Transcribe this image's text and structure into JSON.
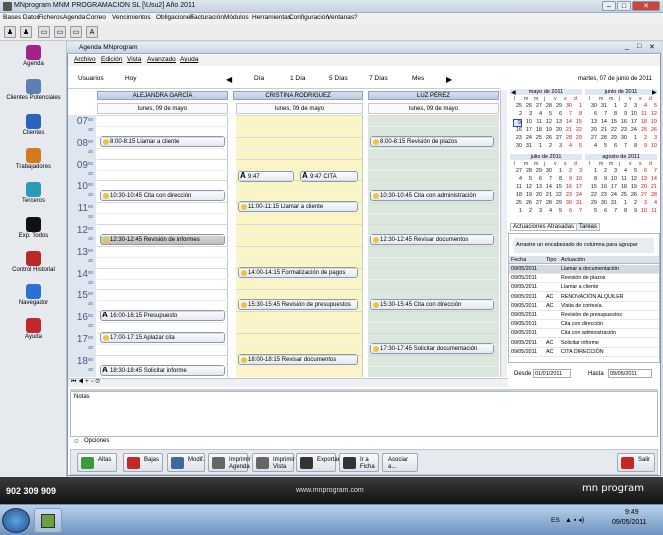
{
  "window": {
    "title": "MNprogram MNM PROGRAMACION SL [\\Usu2] Año 2011"
  },
  "menubar": [
    "Bases Datos",
    "Ficheros",
    "Agenda",
    "Correo",
    "Vencimientos",
    "Obligaciones",
    "Facturación",
    "Módulos",
    "Herramientas",
    "Configuración",
    "Ventanas",
    "?"
  ],
  "sidebar": [
    {
      "label": "Agenda",
      "icon": "agenda-icon"
    },
    {
      "label": "Clientes Potenciales",
      "icon": "potential-clients-icon"
    },
    {
      "label": "Clientes",
      "icon": "clients-icon"
    },
    {
      "label": "Trabajadores",
      "icon": "workers-icon"
    },
    {
      "label": "Terceros",
      "icon": "third-parties-icon"
    },
    {
      "label": "Exp. Todos",
      "icon": "expedients-icon"
    },
    {
      "label": "Control Historial",
      "icon": "history-icon"
    },
    {
      "label": "Navegador",
      "icon": "browser-icon"
    },
    {
      "label": "Ayuda",
      "icon": "help-icon"
    }
  ],
  "inner": {
    "title": "Agenda MNprogram",
    "menu": [
      "Archivo",
      "Edición",
      "Vista",
      "Avanzado",
      "Ayuda"
    ]
  },
  "nav": {
    "usuarios": "Usuarios",
    "hoy": "Hoy",
    "dia": "Día",
    "dia1": "1 Día",
    "dias5": "5 Días",
    "dias7": "7 Días",
    "mes": "Mes",
    "date": "martes, 07 de junio de 2011"
  },
  "columns": [
    {
      "name": "ALEJANDRA GARCÍA",
      "day": "lunes, 09 de mayo"
    },
    {
      "name": "CRISTINA RODRIGUEZ",
      "day": "lunes, 09 de mayo"
    },
    {
      "name": "LUZ PÉREZ",
      "day": "lunes, 09 de mayo"
    }
  ],
  "hours": [
    "07",
    "08",
    "09",
    "10",
    "11",
    "12",
    "13",
    "14",
    "15",
    "16",
    "17",
    "18"
  ],
  "appointments": {
    "c1": [
      "8:00-8:15 Llamar a cliente",
      "10:30-10:45 Cita con dirección",
      "12:30-12:45 Revisión de informes",
      "16:00-16:15 Presupuesto",
      "17:00-17:15 Aplazar cita",
      "18:30-18:45 Solicitar informe"
    ],
    "c2": [
      "9:47",
      "9:47 CITA",
      "11:00-11:15 Llamar a cliente",
      "14:00-14:15 Formalización de pagos",
      "15:30-15:45 Revisión de presupuestos",
      "18:00-18:15 Revisar documentos"
    ],
    "c3": [
      "8:00-8:15 Revisión de plazos",
      "10:30-10:45 Cita con administración",
      "12:30-12:45 Revisar documentos",
      "15:30-15:45 Cita con dirección",
      "17:30-17:45 Solicitar documentación"
    ]
  },
  "calendars": [
    {
      "month": "mayo de 2011",
      "days": "l m m j v s d",
      "rows": [
        "25 26 27 28 29 30 1",
        "2 3 4 5 6 7 8",
        "9 10 11 12 13 14 15",
        "16 17 18 19 20 21 22",
        "23 24 25 26 27 28 29",
        "30 31 1 2 3 4 5"
      ]
    },
    {
      "month": "junio de 2011",
      "days": "l m m j v s d",
      "rows": [
        "30 31 1 2 3 4 5",
        "6 7 8 9 10 11 12",
        "13 14 15 16 17 18 19",
        "20 21 22 23 24 25 26",
        "27 28 29 30 1 2 3",
        "4 5 6 7 8 9 10"
      ]
    },
    {
      "month": "julio de 2011",
      "days": "l m m j v s d",
      "rows": [
        "27 28 29 30 1 2 3",
        "4 5 6 7 8 9 10",
        "11 12 13 14 15 16 17",
        "18 19 20 21 22 23 24",
        "25 26 27 28 29 30 31",
        "1 2 3 4 5 6 7"
      ]
    },
    {
      "month": "agosto de 2011",
      "days": "l m m j v s d",
      "rows": [
        "1 2 3 4 5 6 7",
        "8 9 10 11 12 13 14",
        "15 16 17 18 19 20 21",
        "22 23 24 25 26 27 28",
        "29 30 31 1 2 3 4",
        "5 6 7 8 9 10 11"
      ]
    }
  ],
  "tabs": [
    "Actuaciones Atrasadas",
    "Tareas"
  ],
  "grid": {
    "hint": "Arrastre un encabezado de columna para agrupar",
    "headers": [
      "Fecha",
      "Tipo",
      "Actuación"
    ],
    "rows": [
      [
        "09/05/2011",
        "",
        "Llamar a documentación"
      ],
      [
        "09/05/2011",
        "",
        "Revisión de plazos"
      ],
      [
        "09/05/2011",
        "",
        "Llamar a cliente"
      ],
      [
        "09/05/2011",
        "AC",
        "RENOVACIÓN ALQUILER"
      ],
      [
        "09/05/2011",
        "AC",
        "Visita de cortesía."
      ],
      [
        "09/05/2011",
        "",
        "Revisión de presupuestos"
      ],
      [
        "09/05/2011",
        "",
        "Cita con dirección"
      ],
      [
        "09/05/2011",
        "",
        "Cita con administración"
      ],
      [
        "09/05/2011",
        "AC",
        "Solicitar informe"
      ],
      [
        "09/05/2011",
        "AC",
        "CITA DIRECCIÓN"
      ]
    ]
  },
  "dates": {
    "desde_label": "Desde",
    "desde": "01/01/2011",
    "hasta_label": "Hasta",
    "hasta": "09/05/2011"
  },
  "notas": "Notas",
  "opciones": "Opciones",
  "buttons": [
    "Altas",
    "Bajas",
    "Modif.",
    "Imprimir Agenda",
    "Imprimir Vista",
    "Exportar",
    "Ir a Ficha",
    "Asociar a...",
    "Salir"
  ],
  "footer": {
    "phone": "902 309 909",
    "url": "www.mnprogram.com",
    "brand": "mn program"
  },
  "taskbar": {
    "lang": "ES",
    "time": "9:49",
    "date": "09/05/2011"
  }
}
